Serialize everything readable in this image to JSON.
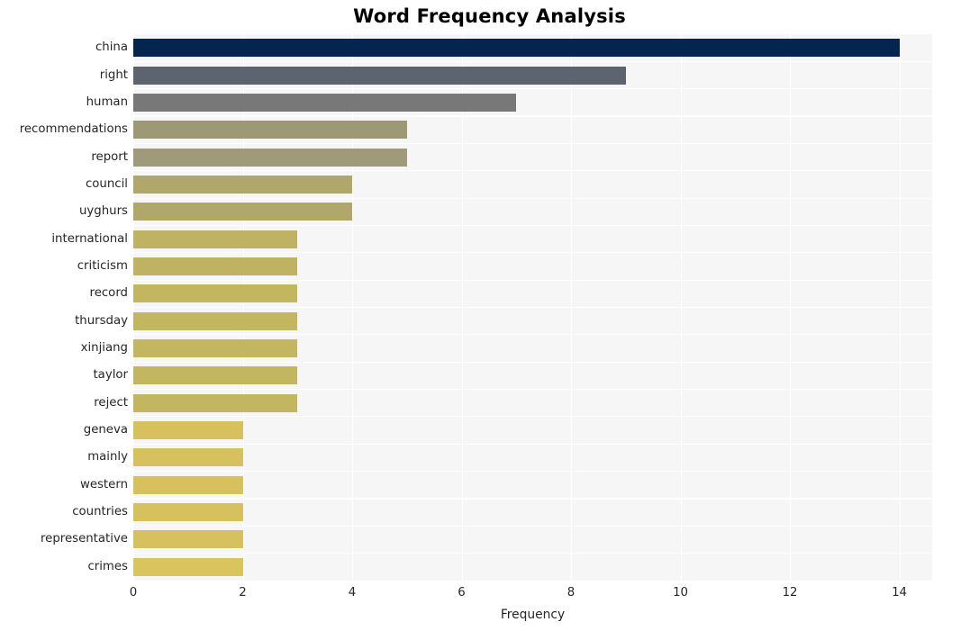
{
  "chart_data": {
    "type": "bar",
    "orientation": "horizontal",
    "title": "Word Frequency Analysis",
    "xlabel": "Frequency",
    "ylabel": "",
    "categories": [
      "china",
      "right",
      "human",
      "recommendations",
      "report",
      "council",
      "uyghurs",
      "international",
      "criticism",
      "record",
      "thursday",
      "xinjiang",
      "taylor",
      "reject",
      "geneva",
      "mainly",
      "western",
      "countries",
      "representative",
      "crimes"
    ],
    "values": [
      14,
      9,
      7,
      5,
      5,
      4,
      4,
      3,
      3,
      3,
      3,
      3,
      3,
      3,
      2,
      2,
      2,
      2,
      2,
      2
    ],
    "xlim": [
      0,
      14.6
    ],
    "xticks": [
      "0",
      "2",
      "4",
      "6",
      "8",
      "10",
      "12",
      "14"
    ],
    "xtick_values": [
      0,
      2,
      4,
      6,
      8,
      10,
      12,
      14
    ],
    "grid": true,
    "grid_axis": "both",
    "legend": "none",
    "bar_colors": [
      "#04254f",
      "#5e6370",
      "#787878",
      "#9d9876",
      "#9f9a79",
      "#b0a86a",
      "#b0a86a",
      "#bfb263",
      "#bfb263",
      "#c3b661",
      "#c3b661",
      "#c3b661",
      "#c3b661",
      "#c3b661",
      "#d6c15e",
      "#d6c15e",
      "#d6c15e",
      "#d6c15e",
      "#d6c15e",
      "#d9c45d"
    ],
    "plot_background": "#f6f6f6",
    "figure_background": "#ffffff",
    "gridline_color": "#ffffff",
    "tick_label_color": "#262626",
    "title_color": "#000000"
  }
}
